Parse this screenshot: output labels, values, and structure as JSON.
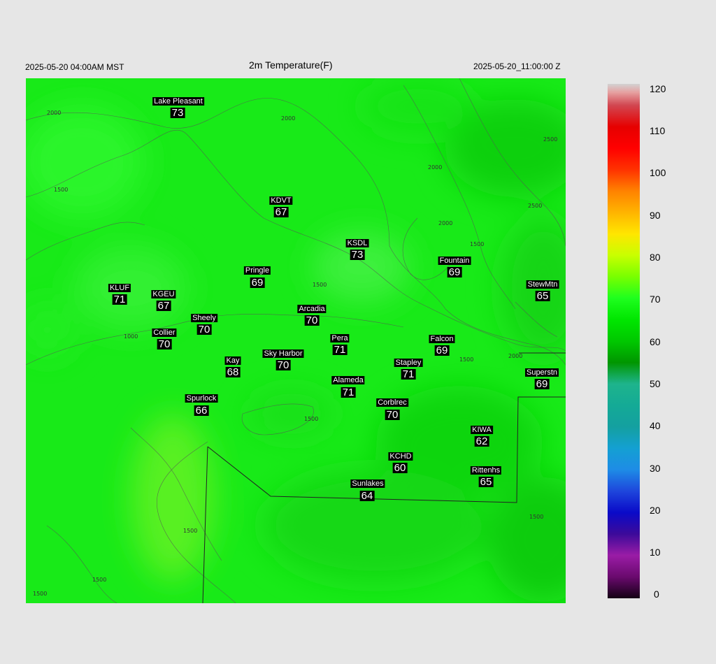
{
  "header": {
    "local_time": "2025-05-20 04:00AM MST",
    "title": "2m Temperature(F)",
    "utc_time": "2025-05-20_11:00:00 Z"
  },
  "colorbar": {
    "ticks": [
      "120",
      "110",
      "100",
      "90",
      "80",
      "70",
      "60",
      "50",
      "40",
      "30",
      "20",
      "10",
      "0"
    ],
    "stops": [
      {
        "v": 0,
        "c": "#140014"
      },
      {
        "v": 5,
        "c": "#6a0a6e"
      },
      {
        "v": 10,
        "c": "#9a1ca6"
      },
      {
        "v": 15,
        "c": "#3c0a9a"
      },
      {
        "v": 20,
        "c": "#0a0ac8"
      },
      {
        "v": 25,
        "c": "#1e46dc"
      },
      {
        "v": 30,
        "c": "#1e8ce6"
      },
      {
        "v": 35,
        "c": "#14a0d2"
      },
      {
        "v": 40,
        "c": "#14a0a0"
      },
      {
        "v": 45,
        "c": "#14aa96"
      },
      {
        "v": 50,
        "c": "#1eb48c"
      },
      {
        "v": 55,
        "c": "#009600"
      },
      {
        "v": 60,
        "c": "#00c800"
      },
      {
        "v": 65,
        "c": "#00e600"
      },
      {
        "v": 70,
        "c": "#1eff1e"
      },
      {
        "v": 75,
        "c": "#78ff00"
      },
      {
        "v": 80,
        "c": "#c8ff00"
      },
      {
        "v": 85,
        "c": "#ffe600"
      },
      {
        "v": 90,
        "c": "#ffb400"
      },
      {
        "v": 95,
        "c": "#ff8200"
      },
      {
        "v": 100,
        "c": "#ff3200"
      },
      {
        "v": 105,
        "c": "#ff0000"
      },
      {
        "v": 110,
        "c": "#e60000"
      },
      {
        "v": 115,
        "c": "#d24650"
      },
      {
        "v": 118,
        "c": "#e6a0a0"
      },
      {
        "v": 120,
        "c": "#d2d2d2"
      }
    ]
  },
  "contour_labels": [
    "2000",
    "1500",
    "1000",
    "2500"
  ],
  "stations": [
    {
      "name": "Lake Pleasant",
      "value": "73"
    },
    {
      "name": "KDVT",
      "value": "67"
    },
    {
      "name": "KSDL",
      "value": "73"
    },
    {
      "name": "Fountain",
      "value": "69"
    },
    {
      "name": "Pringle",
      "value": "69"
    },
    {
      "name": "StewMtn",
      "value": "65"
    },
    {
      "name": "KLUF",
      "value": "71"
    },
    {
      "name": "KGEU",
      "value": "67"
    },
    {
      "name": "Arcadia",
      "value": "70"
    },
    {
      "name": "Sheely",
      "value": "70"
    },
    {
      "name": "Collier",
      "value": "70"
    },
    {
      "name": "Pera",
      "value": "71"
    },
    {
      "name": "Falcon",
      "value": "69"
    },
    {
      "name": "Kay",
      "value": "68"
    },
    {
      "name": "Sky Harbor",
      "value": "70"
    },
    {
      "name": "Stapley",
      "value": "71"
    },
    {
      "name": "Superstn",
      "value": "69"
    },
    {
      "name": "Alameda",
      "value": "71"
    },
    {
      "name": "Spurlock",
      "value": "66"
    },
    {
      "name": "Corblrec",
      "value": "70"
    },
    {
      "name": "KIWA",
      "value": "62"
    },
    {
      "name": "KCHD",
      "value": "60"
    },
    {
      "name": "Rittenhs",
      "value": "65"
    },
    {
      "name": "Sunlakes",
      "value": "64"
    }
  ]
}
